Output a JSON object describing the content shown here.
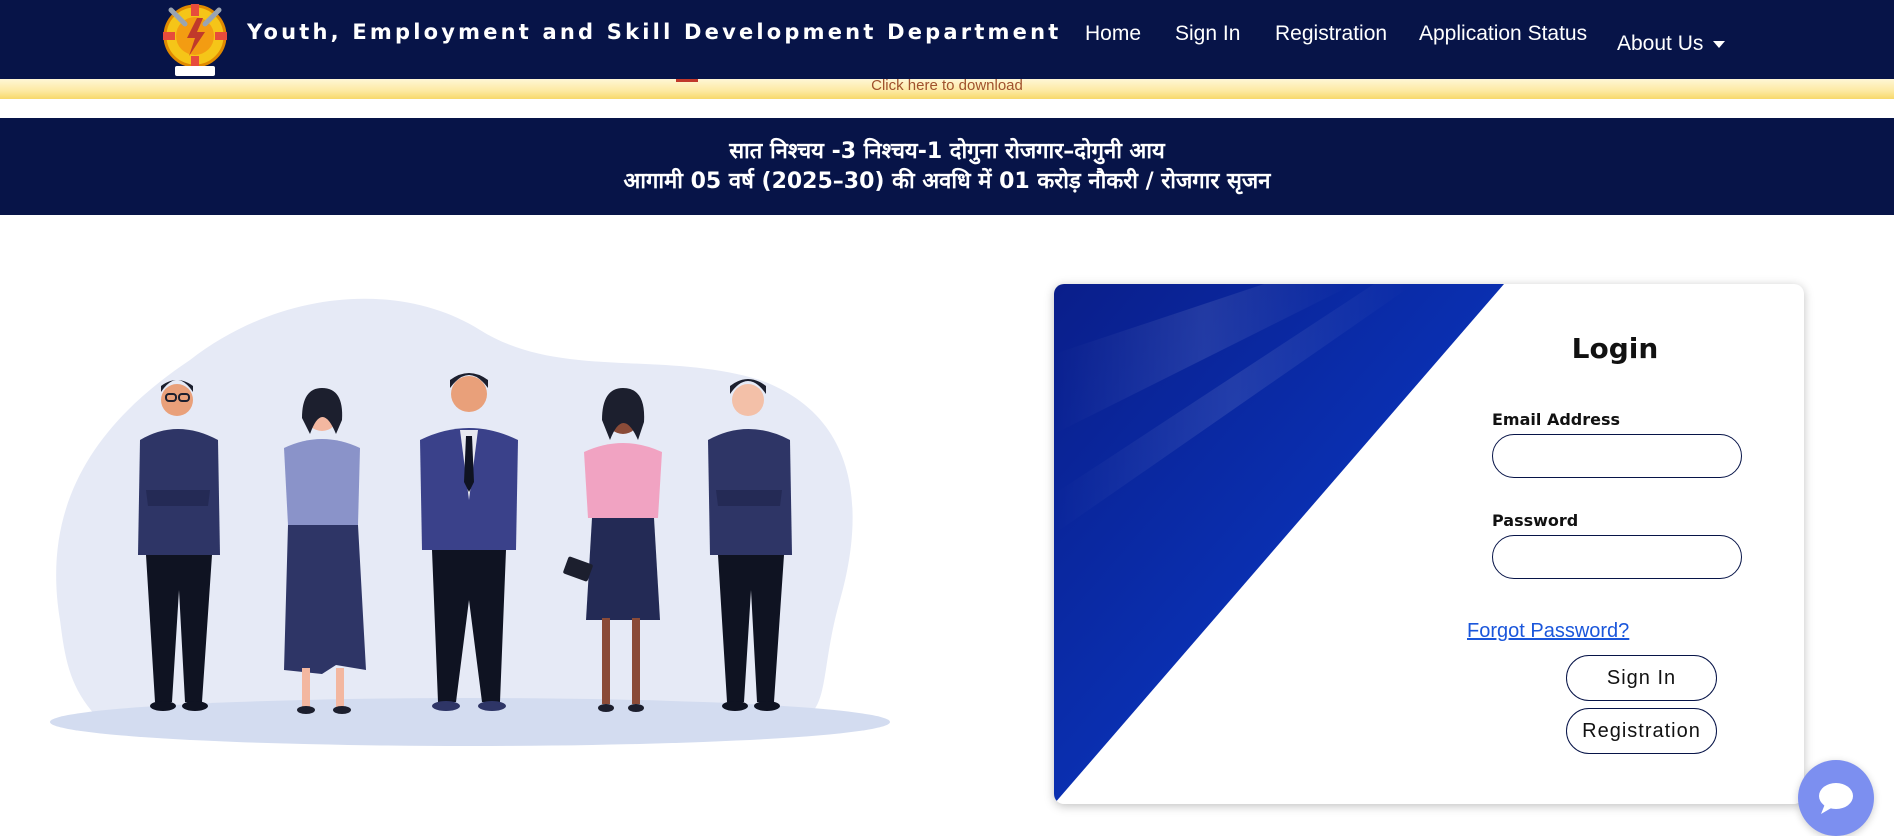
{
  "header": {
    "title": "Youth, Employment and Skill Development Department",
    "logo_icon": "department-gear-logo-icon",
    "nav": [
      {
        "label": "Home"
      },
      {
        "label": "Sign In"
      },
      {
        "label": "Registration"
      },
      {
        "label": "Application Status"
      },
      {
        "label": "About Us",
        "dropdown_icon": "caret-down-icon"
      }
    ]
  },
  "notice": {
    "link_text": "Click here to download"
  },
  "banner": {
    "line1": "सात निश्चय -3 निश्चय-1 दोगुना रोजगार–दोगुनी आय",
    "line2": "आगामी 05 वर्ष (2025–30) की अवधि में 01 करोड़ नौकरी / रोजगार सृजन"
  },
  "login": {
    "title": "Login",
    "email_label": "Email Address",
    "email_value": "",
    "password_label": "Password",
    "password_value": "",
    "forgot_link": "Forgot Password?",
    "sign_in_button": "Sign In",
    "registration_button": "Registration"
  },
  "chat": {
    "icon": "chat-bubble-icon"
  },
  "colors": {
    "navy": "#071448",
    "accent_blue": "#0a2a9e",
    "link_blue": "#1a56db",
    "notice_yellow": "#fde9a1",
    "chat_button": "#7c8ff0"
  }
}
